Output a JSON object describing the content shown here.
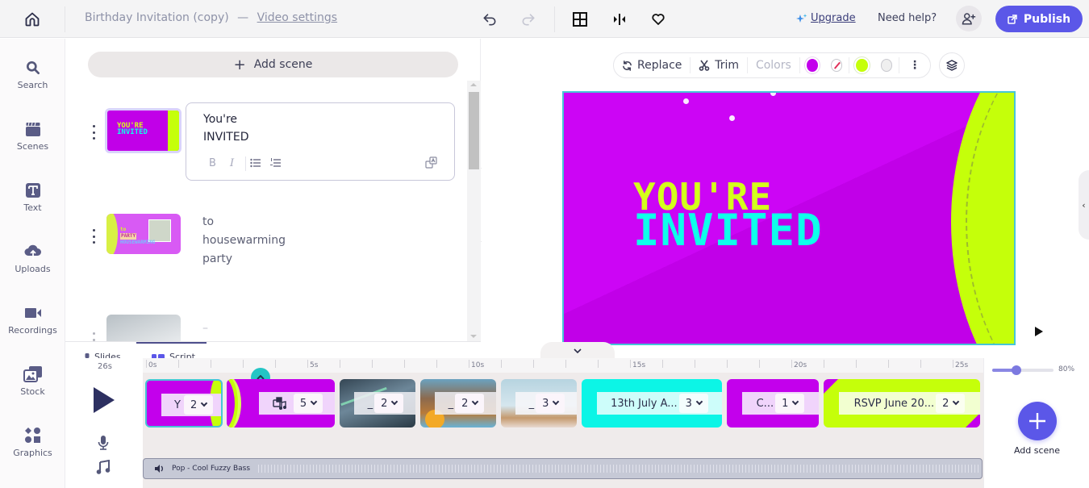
{
  "header": {
    "project_title": "Birthday Invitation (copy)",
    "separator": "—",
    "video_settings_link": "Video settings",
    "upgrade_label": "Upgrade",
    "help_label": "Need help?",
    "publish_label": "Publish",
    "icons": [
      "home-icon",
      "undo-icon",
      "redo-icon",
      "grid-icon",
      "split-icon",
      "heart-icon",
      "sparkle-icon",
      "add-user-icon",
      "external-link-icon"
    ]
  },
  "sidebar": {
    "items": [
      {
        "label": "Search",
        "icon": "search-icon"
      },
      {
        "label": "Scenes",
        "icon": "clapperboard-icon"
      },
      {
        "label": "Text",
        "icon": "text-icon"
      },
      {
        "label": "Uploads",
        "icon": "cloud-upload-icon"
      },
      {
        "label": "Recordings",
        "icon": "video-camera-icon"
      },
      {
        "label": "Stock",
        "icon": "stock-images-icon"
      },
      {
        "label": "Graphics",
        "icon": "shapes-icon"
      }
    ]
  },
  "script_panel": {
    "add_scene_label": "Add scene",
    "scenes": [
      {
        "line1": "You're",
        "line2": "INVITED",
        "thumbnail_text": [
          "YOU'RE",
          "INVITED"
        ]
      },
      {
        "line1": "to",
        "line2": "housewarming",
        "line3": "party",
        "thumbnail_text": [
          "to",
          "PARTY",
          "HOUSEWARMING"
        ]
      },
      {
        "line1": "–"
      }
    ],
    "format_buttons": [
      "B",
      "I"
    ],
    "tabs": [
      {
        "label": "Slides",
        "active": false
      },
      {
        "label": "Script",
        "active": true
      }
    ]
  },
  "canvas": {
    "toolbar": {
      "replace_label": "Replace",
      "trim_label": "Trim",
      "colors_label": "Colors",
      "swatches": [
        "#c300ec",
        "none",
        "#c5ff0a",
        "#eeeeee"
      ]
    },
    "headline_line1": "YOU'RE",
    "headline_line2": "INVITED",
    "colors": {
      "purple": "#c300ec",
      "lime": "#c5ff0a",
      "cyan": "#0effeb",
      "selection": "#46c6d6"
    }
  },
  "timeline": {
    "total_duration": "26s",
    "ruler_labels": [
      "0s",
      "5s",
      "10s",
      "15s",
      "20s",
      "25s"
    ],
    "clips": [
      {
        "label": "Y",
        "count": "2",
        "bg": "#c300ec",
        "selected": true
      },
      {
        "label": "",
        "count": "5",
        "bg": "#c300ec",
        "has_music_icon": true
      },
      {
        "label": "_",
        "count": "2",
        "bg": "#5a7080"
      },
      {
        "label": "_",
        "count": "2",
        "bg": "#a38a6e"
      },
      {
        "label": "_",
        "count": "3",
        "bg": "#b9d4de"
      },
      {
        "label": "13th July A...",
        "count": "3",
        "bg": "#0cf5e6"
      },
      {
        "label": "C...",
        "count": "1",
        "bg": "#c300ec"
      },
      {
        "label": "RSVP June 20...",
        "count": "2",
        "bg": "#c5ff0a"
      }
    ],
    "audio_track": "Pop - Cool Fuzzy Bass",
    "zoom_percent": "80%",
    "zoom_fraction": 0.4,
    "add_scene_label": "Add scene"
  }
}
